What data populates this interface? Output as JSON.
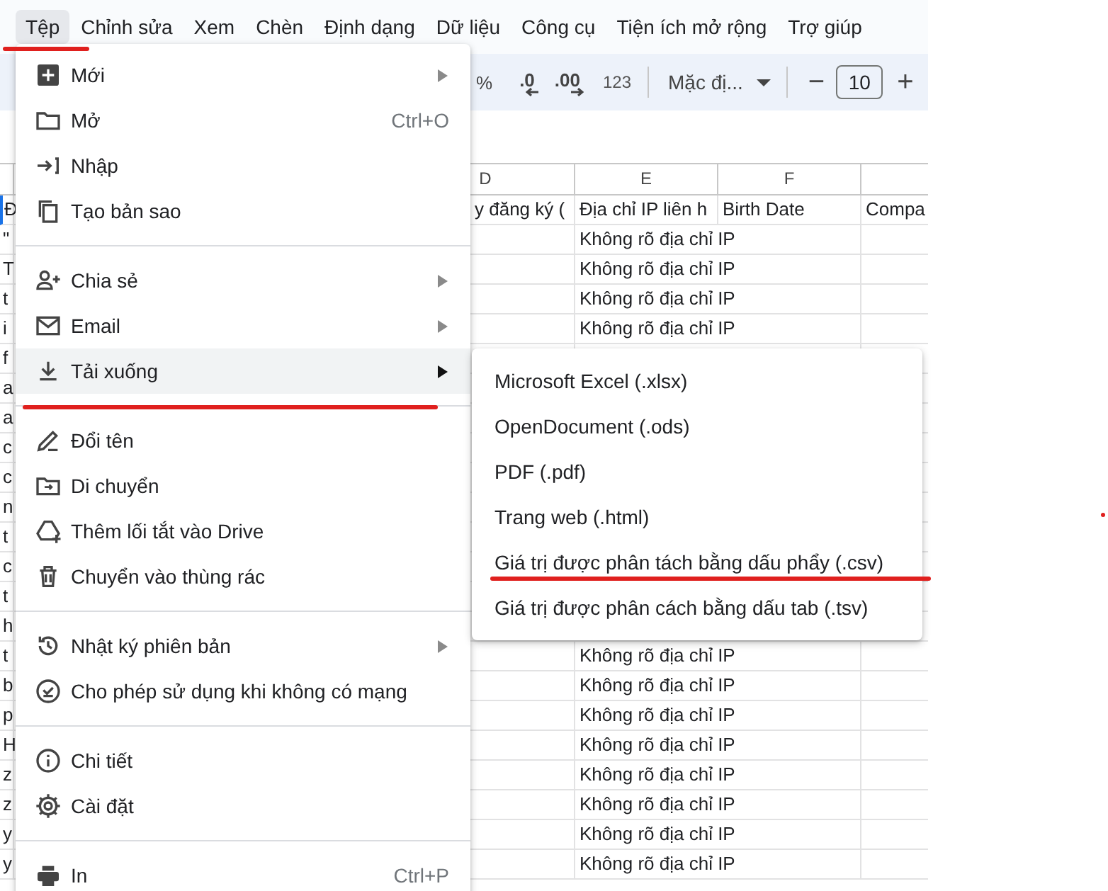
{
  "menu_bar": [
    {
      "label": "Tệp",
      "selected": true
    },
    {
      "label": "Chỉnh sửa",
      "selected": false
    },
    {
      "label": "Xem",
      "selected": false
    },
    {
      "label": "Chèn",
      "selected": false
    },
    {
      "label": "Định dạng",
      "selected": false
    },
    {
      "label": "Dữ liệu",
      "selected": false
    },
    {
      "label": "Công cụ",
      "selected": false
    },
    {
      "label": "Tiện ích mở rộng",
      "selected": false
    },
    {
      "label": "Trợ giúp",
      "selected": false
    }
  ],
  "toolbar": {
    "percent": "%",
    "decrease_decimals": ".0",
    "increase_decimals": ".00",
    "number_format": "123",
    "font": "Mặc đị...",
    "size_decrease": "−",
    "font_size": "10",
    "size_increase": "+"
  },
  "sheet": {
    "columns": [
      "D",
      "E",
      "F"
    ],
    "header_row": {
      "a": "Đ",
      "d": "y đăng ký (",
      "e": "Địa chỉ IP liên h",
      "f": "Birth Date",
      "g": "Compa"
    },
    "rows": [
      {
        "a": "\"",
        "e": "Không rõ địa chỉ IP"
      },
      {
        "a": "T",
        "e": "Không rõ địa chỉ IP"
      },
      {
        "a": "t",
        "e": "Không rõ địa chỉ IP"
      },
      {
        "a": "i",
        "e": "Không rõ địa chỉ IP"
      },
      {
        "a": "f"
      },
      {
        "a": "a"
      },
      {
        "a": "a"
      },
      {
        "a": "c"
      },
      {
        "a": "c"
      },
      {
        "a": "n"
      },
      {
        "a": "t"
      },
      {
        "a": "c"
      },
      {
        "a": "t"
      },
      {
        "a": "h"
      },
      {
        "a": "t",
        "e": "Không rõ địa chỉ IP"
      },
      {
        "a": "b",
        "e": "Không rõ địa chỉ IP"
      },
      {
        "a": "p",
        "e": "Không rõ địa chỉ IP"
      },
      {
        "a": "H",
        "e": "Không rõ địa chỉ IP"
      },
      {
        "a": "z",
        "e": "Không rõ địa chỉ IP"
      },
      {
        "a": "z",
        "e": "Không rõ địa chỉ IP"
      },
      {
        "a": "y",
        "e": "Không rõ địa chỉ IP"
      },
      {
        "a": "y",
        "e": "Không rõ địa chỉ IP"
      }
    ]
  },
  "file_menu": [
    {
      "kind": "item",
      "label": "Mới",
      "submenu": true,
      "selected": false
    },
    {
      "kind": "item",
      "label": "Mở",
      "shortcut": "Ctrl+O",
      "submenu": false,
      "selected": false
    },
    {
      "kind": "item",
      "label": "Nhập",
      "submenu": false,
      "selected": false
    },
    {
      "kind": "item",
      "label": "Tạo bản sao",
      "submenu": false,
      "selected": false
    },
    {
      "kind": "separator"
    },
    {
      "kind": "item",
      "label": "Chia sẻ",
      "submenu": true,
      "selected": false
    },
    {
      "kind": "item",
      "label": "Email",
      "submenu": true,
      "selected": false
    },
    {
      "kind": "item",
      "label": "Tải xuống",
      "submenu": true,
      "selected": true
    },
    {
      "kind": "separator"
    },
    {
      "kind": "item",
      "label": "Đổi tên",
      "submenu": false,
      "selected": false
    },
    {
      "kind": "item",
      "label": "Di chuyển",
      "submenu": false,
      "selected": false
    },
    {
      "kind": "item",
      "label": "Thêm lối tắt vào Drive",
      "submenu": false,
      "selected": false
    },
    {
      "kind": "item",
      "label": "Chuyển vào thùng rác",
      "submenu": false,
      "selected": false
    },
    {
      "kind": "separator"
    },
    {
      "kind": "item",
      "label": "Nhật ký phiên bản",
      "submenu": true,
      "selected": false
    },
    {
      "kind": "item",
      "label": "Cho phép sử dụng khi không có mạng",
      "submenu": false,
      "selected": false
    },
    {
      "kind": "separator"
    },
    {
      "kind": "item",
      "label": "Chi tiết",
      "submenu": false,
      "selected": false
    },
    {
      "kind": "item",
      "label": "Cài đặt",
      "submenu": false,
      "selected": false
    },
    {
      "kind": "separator"
    },
    {
      "kind": "item",
      "label": "In",
      "shortcut": "Ctrl+P",
      "submenu": false,
      "selected": false
    }
  ],
  "download_submenu": [
    {
      "label": "Microsoft Excel (.xlsx)"
    },
    {
      "label": "OpenDocument (.ods)"
    },
    {
      "label": "PDF (.pdf)"
    },
    {
      "label": "Trang web (.html)"
    },
    {
      "label": "Giá trị được phân tách bằng dấu phẩy (.csv)"
    },
    {
      "label": "Giá trị được phân cách bằng dấu tab (.tsv)"
    }
  ],
  "annotations": [
    {
      "kind": "underline"
    },
    {
      "kind": "underline"
    },
    {
      "kind": "underline"
    },
    {
      "kind": "dot"
    }
  ]
}
